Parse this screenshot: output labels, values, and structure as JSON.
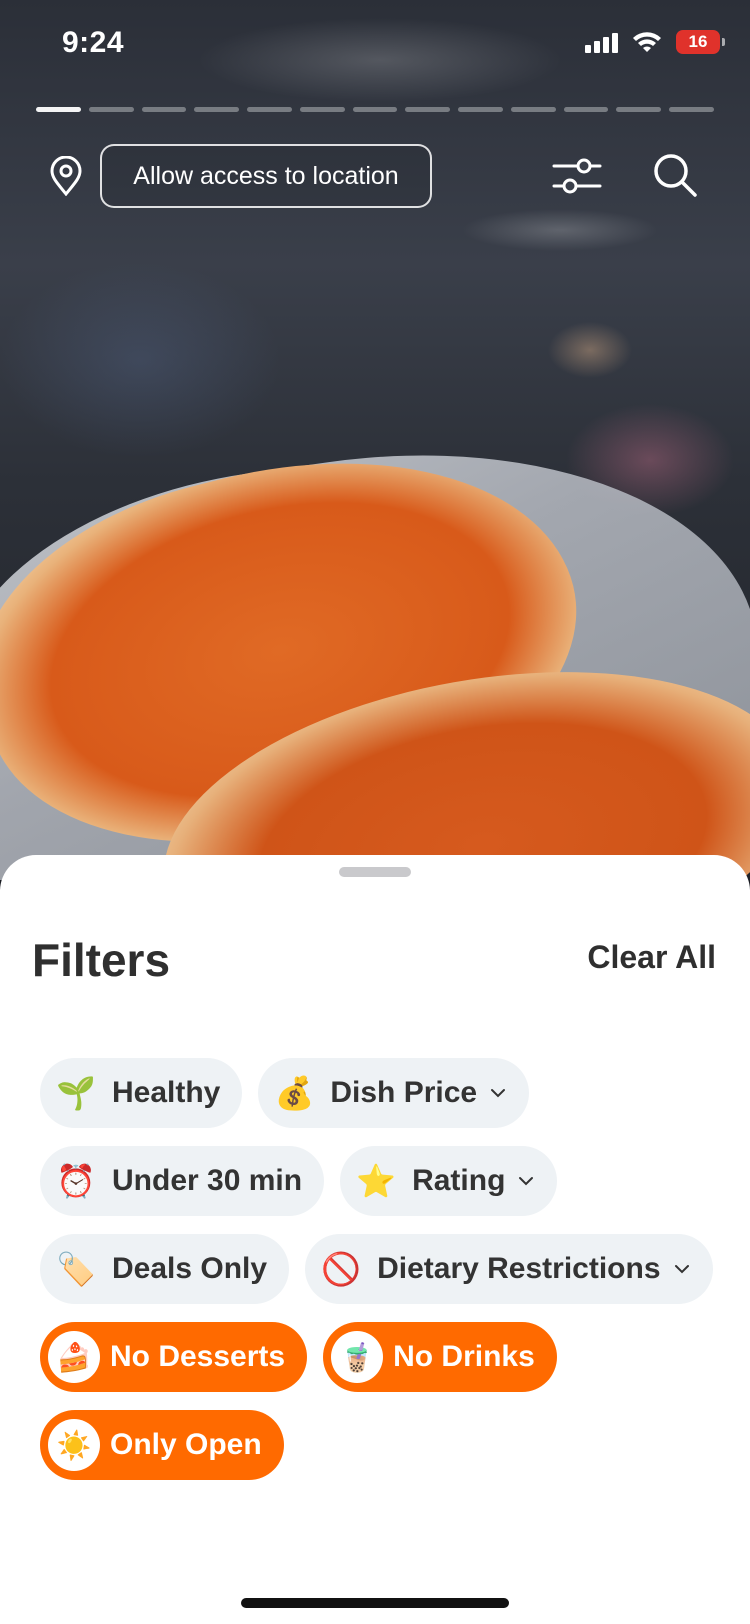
{
  "status_bar": {
    "time": "9:24",
    "battery": "16"
  },
  "story": {
    "segments": 13,
    "active_index": 0
  },
  "top_bar": {
    "location_prompt": "Allow access to location",
    "icons": [
      "location-pin-icon",
      "filter-sliders-icon",
      "search-icon"
    ]
  },
  "filters": {
    "title": "Filters",
    "clear_all": "Clear All",
    "chips": [
      {
        "emoji": "🌱",
        "label": "Healthy",
        "dropdown": false,
        "selected": false
      },
      {
        "emoji": "💰",
        "label": "Dish Price",
        "dropdown": true,
        "selected": false
      },
      {
        "emoji": "⏰",
        "label": "Under 30 min",
        "dropdown": false,
        "selected": false
      },
      {
        "emoji": "⭐",
        "label": "Rating",
        "dropdown": true,
        "selected": false
      },
      {
        "emoji": "🏷️",
        "label": "Deals Only",
        "dropdown": false,
        "selected": false
      },
      {
        "emoji": "🚫",
        "label": "Dietary Restrictions",
        "dropdown": true,
        "selected": false
      },
      {
        "emoji": "🍰",
        "label": "No Desserts",
        "dropdown": false,
        "selected": true
      },
      {
        "emoji": "🧋",
        "label": "No Drinks",
        "dropdown": false,
        "selected": true
      },
      {
        "emoji": "☀️",
        "label": "Only Open",
        "dropdown": false,
        "selected": true
      }
    ]
  },
  "colors": {
    "accent": "#ff6a00",
    "chip_bg": "#eef2f5",
    "battery": "#e0322b"
  }
}
